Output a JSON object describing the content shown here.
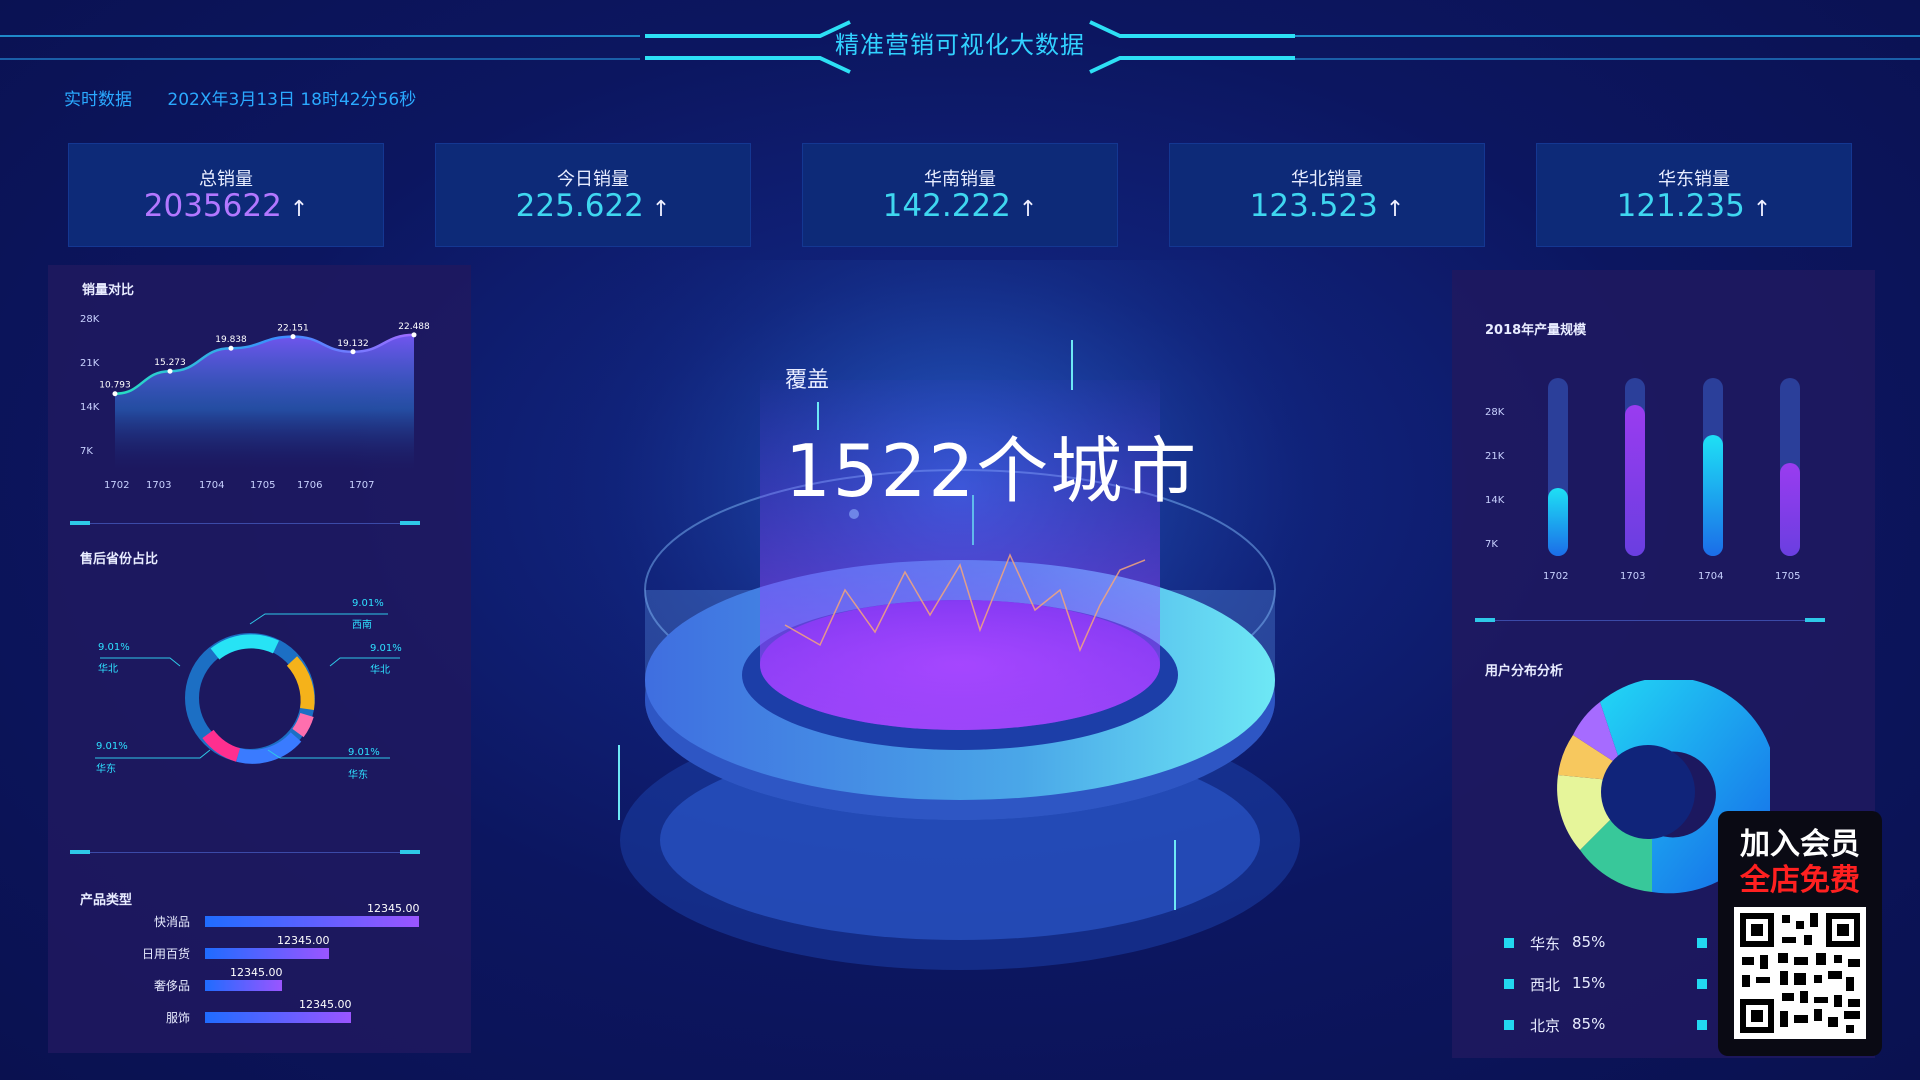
{
  "header": {
    "title": "精准营销可视化大数据",
    "live_label": "实时数据",
    "datetime": "202X年3月13日  18时42分56秒"
  },
  "stats": [
    {
      "label": "总销量",
      "value": "2035622",
      "color": "#b277ff"
    },
    {
      "label": "今日销量",
      "value": "225.622",
      "color": "#3fd7f0"
    },
    {
      "label": "华南销量",
      "value": "142.222",
      "color": "#3fd7f0"
    },
    {
      "label": "华北销量",
      "value": "123.523",
      "color": "#3fd7f0"
    },
    {
      "label": "华东销量",
      "value": "121.235",
      "color": "#3fd7f0"
    }
  ],
  "arrow": "↑",
  "center": {
    "cover_label": "覆盖",
    "headline": "1522个城市"
  },
  "left": {
    "sales_compare": {
      "title": "销量对比",
      "yticks": [
        "28K",
        "21K",
        "14K",
        "7K"
      ],
      "xticks": [
        "1702",
        "1703",
        "1704",
        "1705",
        "1706",
        "1707"
      ],
      "point_labels": [
        "10.793",
        "15.273",
        "19.838",
        "22.151",
        "19.132",
        "22.488"
      ]
    },
    "province_share": {
      "title": "售后省份占比",
      "labels": [
        {
          "pct": "9.01%",
          "region": "西南"
        },
        {
          "pct": "9.01%",
          "region": "华北"
        },
        {
          "pct": "9.01%",
          "region": "华北"
        },
        {
          "pct": "9.01%",
          "region": "华东"
        },
        {
          "pct": "9.01%",
          "region": "华东"
        }
      ]
    },
    "product_type": {
      "title": "产品类型",
      "items": [
        {
          "name": "快消品",
          "value": "12345.00",
          "fill": 1.0
        },
        {
          "name": "日用百货",
          "value": "12345.00",
          "fill": 0.58
        },
        {
          "name": "奢侈品",
          "value": "12345.00",
          "fill": 0.36
        },
        {
          "name": "服饰",
          "value": "12345.00",
          "fill": 0.68
        }
      ]
    }
  },
  "right": {
    "production": {
      "title": "2018年产量规模",
      "yticks": [
        "28K",
        "21K",
        "14K",
        "7K"
      ],
      "bars": [
        {
          "label": "1702",
          "fill": 0.38,
          "color": "cyan"
        },
        {
          "label": "1703",
          "fill": 0.85,
          "color": "purple"
        },
        {
          "label": "1704",
          "fill": 0.68,
          "color": "cyan"
        },
        {
          "label": "1705",
          "fill": 0.52,
          "color": "purple"
        }
      ]
    },
    "user_dist": {
      "title": "用户分布分析",
      "legend": [
        {
          "name": "华东",
          "value": "85%"
        },
        {
          "name": "西北",
          "value": "15%"
        },
        {
          "name": "北京",
          "value": "85%"
        }
      ]
    }
  },
  "promo": {
    "line1": "加入会员",
    "line2": "全店免费"
  },
  "chart_data": [
    {
      "type": "area",
      "title": "销量对比",
      "categories": [
        "1702",
        "1703",
        "1704",
        "1705",
        "1706",
        "1707"
      ],
      "series": [
        {
          "values": [
            10.793,
            15.273,
            19.838,
            22.151,
            19.132,
            22.488
          ]
        }
      ],
      "ylabel": "",
      "ylim": [
        0,
        28
      ]
    },
    {
      "type": "bar",
      "title": "产品类型",
      "categories": [
        "快消品",
        "日用百货",
        "奢侈品",
        "服饰"
      ],
      "values": [
        12345.0,
        12345.0,
        12345.0,
        12345.0
      ]
    },
    {
      "type": "bar",
      "title": "2018年产量规模",
      "categories": [
        "1702",
        "1703",
        "1704",
        "1705"
      ],
      "values": [
        10.5,
        23.8,
        19.0,
        14.6
      ],
      "ylim": [
        0,
        28
      ]
    },
    {
      "type": "pie",
      "title": "用户分布分析",
      "categories": [
        "华东",
        "西北",
        "北京"
      ],
      "values": [
        85,
        15,
        85
      ]
    }
  ]
}
